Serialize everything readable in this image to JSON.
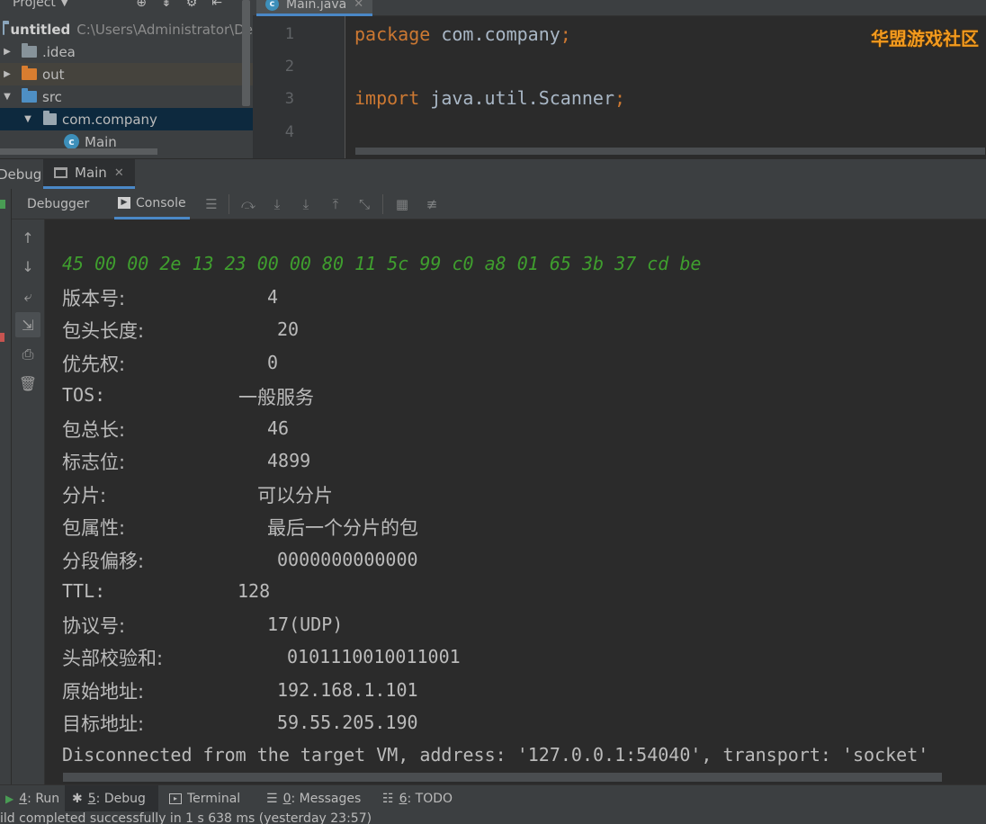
{
  "project_pane": {
    "header_label": "Project",
    "tree": [
      {
        "label": "untitled",
        "path": "C:\\Users\\Administrator\\De",
        "kind": "module",
        "expanded": true
      },
      {
        "label": ".idea",
        "kind": "folder",
        "expanded": false
      },
      {
        "label": "out",
        "kind": "folder-excluded",
        "expanded": false
      },
      {
        "label": "src",
        "kind": "source-folder",
        "expanded": true
      },
      {
        "label": "com.company",
        "kind": "package",
        "expanded": true,
        "selected": true
      },
      {
        "label": "Main",
        "kind": "class"
      }
    ]
  },
  "editor": {
    "tab_label": "Main.java",
    "line_numbers": [
      "1",
      "2",
      "3",
      "4"
    ],
    "lines": [
      {
        "keyword": "package",
        "rest": " com.company",
        "punct": ";"
      },
      {
        "keyword": "",
        "rest": "",
        "punct": ""
      },
      {
        "keyword": "import",
        "rest": " java.util.Scanner",
        "punct": ";"
      }
    ],
    "watermark": "华盟游戏社区"
  },
  "debug": {
    "label": "Debug:",
    "session_tab": "Main",
    "subtabs": {
      "debugger": "Debugger",
      "console": "Console"
    }
  },
  "console": {
    "hex": "45 00 00 2e 13 23 00 00 80 11 5c 99 c0 a8 01 65 3b 37 cd be",
    "fields": [
      {
        "key": "版本号:",
        "value": "4"
      },
      {
        "key": "包头长度:",
        "value": "20"
      },
      {
        "key": "优先权:",
        "value": "0"
      },
      {
        "key": "TOS:",
        "value": "一般服务"
      },
      {
        "key": "包总长:",
        "value": "46"
      },
      {
        "key": "标志位:",
        "value": "4899"
      },
      {
        "key": "分片:",
        "value": "可以分片"
      },
      {
        "key": "包属性:",
        "value": "最后一个分片的包"
      },
      {
        "key": "分段偏移:",
        "value": "0000000000000"
      },
      {
        "key": "TTL:",
        "value": "128"
      },
      {
        "key": "协议号:",
        "value": "17(UDP)"
      },
      {
        "key": "头部校验和:",
        "value": "0101110010011001"
      },
      {
        "key": "原始地址:",
        "value": "192.168.1.101"
      },
      {
        "key": "目标地址:",
        "value": "59.55.205.190"
      }
    ],
    "disconnect": "Disconnected from the target VM, address: '127.0.0.1:54040', transport: 'socket'"
  },
  "bottom_bar": {
    "run": {
      "num": "4",
      "label": ": Run"
    },
    "debug": {
      "num": "5",
      "label": ": Debug"
    },
    "terminal": {
      "label": "Terminal"
    },
    "messages": {
      "num": "0",
      "label": ": Messages"
    },
    "todo": {
      "num": "6",
      "label": ": TODO"
    }
  },
  "status_bar": {
    "text": "ild completed successfully in 1 s 638 ms (yesterday 23:57)"
  },
  "colors": {
    "accent": "#4a88c7",
    "keyword": "#cc7832",
    "hex_output": "#3f9e2e",
    "watermark": "#f39a1e"
  }
}
